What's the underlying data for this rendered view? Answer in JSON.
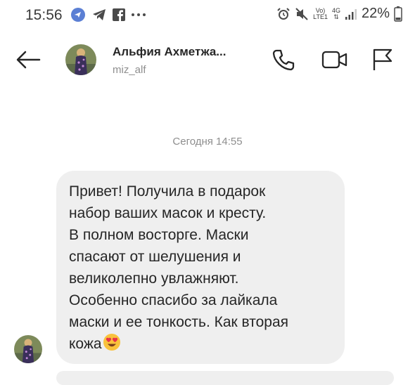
{
  "status_bar": {
    "time": "15:56",
    "battery": "22%",
    "network_top": "Vo)",
    "network_bottom": "LTE1",
    "signal_label": "4G"
  },
  "header": {
    "contact_name": "Альфия Ахметжа...",
    "username": "miz_alf"
  },
  "conversation": {
    "date_separator": "Сегодня 14:55",
    "message": {
      "lines": [
        "Привет! Получила в подарок",
        "набор ваших масок и кресту.",
        "В полном восторге. Маски",
        "спасают от шелушения и",
        "великолепно увлажняют.",
        "Особенно спасибо за лайкала",
        "маски и ее тонкость. Как вторая",
        "кожа"
      ]
    }
  },
  "colors": {
    "bubble_bg": "#efefef",
    "muted_text": "#8e8e8e",
    "primary_text": "#262626"
  },
  "icons": {
    "back": "arrow-left-icon",
    "call": "phone-icon",
    "video": "video-camera-icon",
    "report": "flag-icon"
  }
}
